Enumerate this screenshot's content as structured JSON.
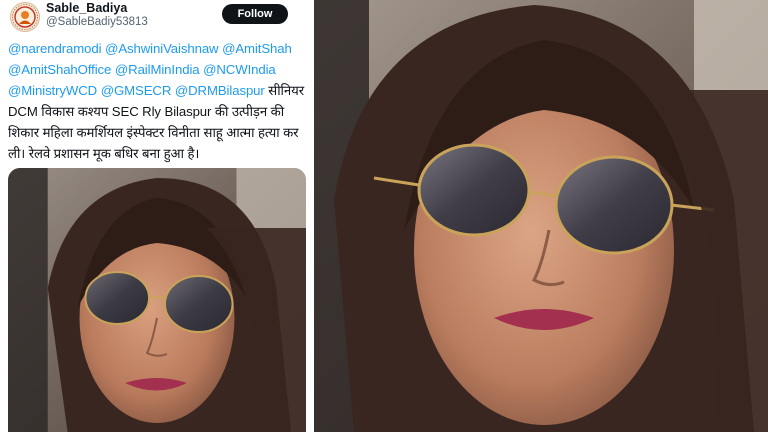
{
  "tweet": {
    "display_name": "Sable_Badiya",
    "handle": "@SableBadiy53813",
    "follow_label": "Follow",
    "lines": [
      [
        {
          "text": "@narendramodi",
          "type": "mention"
        },
        {
          "text": " ",
          "type": "text"
        },
        {
          "text": "@AshwiniVaishnaw",
          "type": "mention"
        },
        {
          "text": " ",
          "type": "text"
        },
        {
          "text": "@AmitShah",
          "type": "mention"
        }
      ],
      [
        {
          "text": "@AmitShahOffice",
          "type": "mention"
        },
        {
          "text": " ",
          "type": "text"
        },
        {
          "text": "@RailMinIndia",
          "type": "mention"
        },
        {
          "text": " ",
          "type": "text"
        },
        {
          "text": "@NCWIndia",
          "type": "mention"
        }
      ],
      [
        {
          "text": "@MinistryWCD",
          "type": "mention"
        },
        {
          "text": " ",
          "type": "text"
        },
        {
          "text": "@GMSECR",
          "type": "mention"
        },
        {
          "text": " ",
          "type": "text"
        },
        {
          "text": "@DRMBilaspur",
          "type": "mention"
        },
        {
          "text": " सीनियर",
          "type": "text"
        }
      ],
      [
        {
          "text": "DCM विकास कश्यप SEC Rly Bilaspur की उत्पीड़न की",
          "type": "text"
        }
      ],
      [
        {
          "text": "शिकार महिला कमर्शियल इंस्पेक्टर विनीता साहू आत्मा हत्या कर",
          "type": "text"
        }
      ],
      [
        {
          "text": "ली। रेलवे प्रशासन मूक बधिर बना हुआ है।",
          "type": "text"
        }
      ]
    ]
  },
  "colors": {
    "text": "#0f1419",
    "mention": "#1d9bf0",
    "secondary": "#536471",
    "follow_bg": "#0f1419"
  },
  "icons": {
    "avatar": "avatar-logo-icon"
  }
}
